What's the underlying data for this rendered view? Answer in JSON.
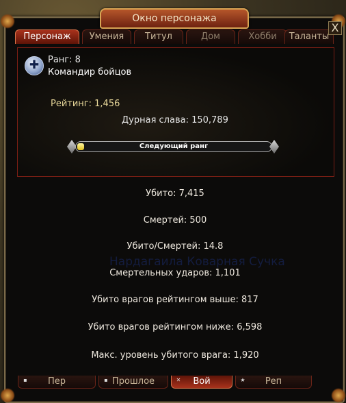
{
  "window": {
    "title": "Окно персонажа",
    "close_symbol": "X"
  },
  "tabs": [
    {
      "label": "Персонаж",
      "active": true
    },
    {
      "label": "Умения",
      "active": false
    },
    {
      "label": "Титул",
      "active": false
    },
    {
      "label": "Дом",
      "active": false,
      "dim": true
    },
    {
      "label": "Хобби",
      "active": false,
      "dim": true
    },
    {
      "label": "Таланты",
      "active": false
    }
  ],
  "rank": {
    "icon": "rank-cross-icon",
    "rank_text": "Ранг: 8",
    "title": "Командир бойцов",
    "rating": "Рейтинг: 1,456",
    "infamy": "Дурная слава: 150,789",
    "next_rank_label": "Следующий ранг",
    "progress": 0.035
  },
  "stats": [
    "Убито: 7,415",
    "Смертей: 500",
    "Убито/Смертей: 14.8",
    "Смертельных ударов: 1,101",
    "Убито врагов рейтингом выше: 817",
    "Убито врагов рейтингом ниже: 6,598",
    "Макс. уровень убитого врага: 1,920"
  ],
  "watermark": "Нардагаила Коварная Сучка",
  "bottom_tabs": [
    {
      "label": "Пер",
      "active": false
    },
    {
      "label": "Прошлое",
      "active": false
    },
    {
      "label": "Вой",
      "active": true
    },
    {
      "label": "Реп",
      "active": false
    }
  ],
  "colors": {
    "accent": "#a8321c",
    "frame": "#7a6a4a",
    "rating_text": "#e8d89a"
  }
}
